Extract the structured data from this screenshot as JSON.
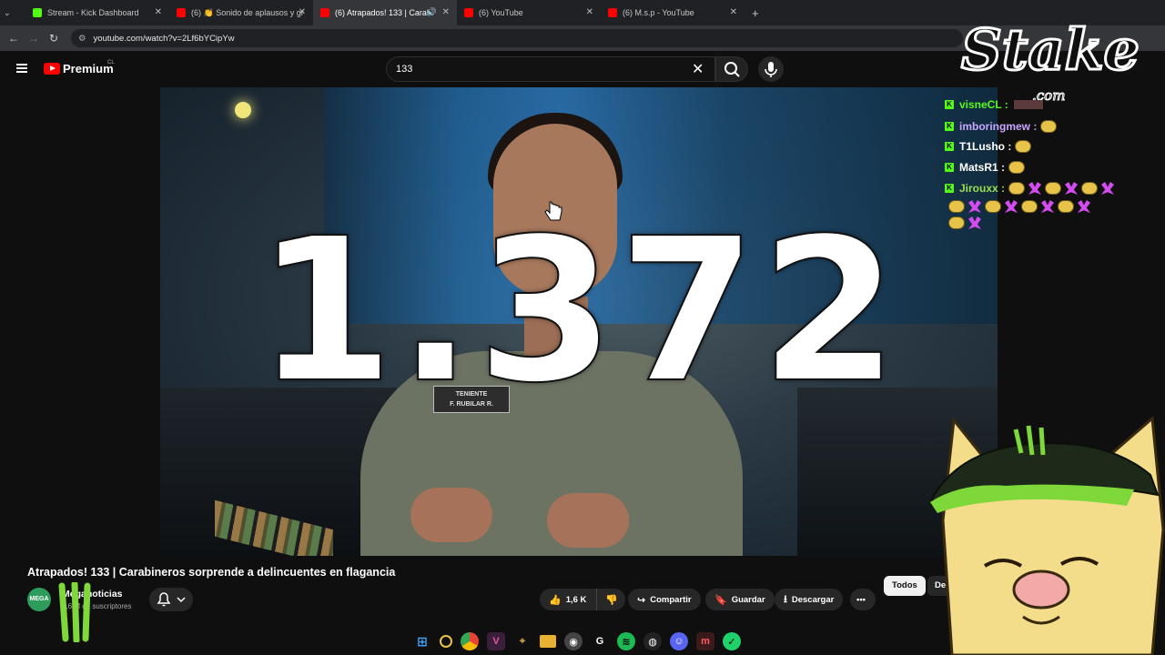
{
  "browser": {
    "tabs": [
      {
        "label": "Stream - Kick Dashboard",
        "color": "#53fc18",
        "active": false
      },
      {
        "label": "(6) 👏 Sonido de aplausos y gr",
        "color": "#ff0000",
        "active": false
      },
      {
        "label": "(6) Atrapados! 133 | Carabi",
        "color": "#ff0000",
        "active": true
      },
      {
        "label": "(6) YouTube",
        "color": "#ff0000",
        "active": false
      },
      {
        "label": "(6) M.s.p - YouTube",
        "color": "#ff0000",
        "active": false
      }
    ],
    "url": "youtube.com/watch?v=2Lf6bYCipYw"
  },
  "youtube": {
    "brand": "Premium",
    "region": "CL",
    "search_query": "133",
    "video": {
      "overlay_number": "1.372",
      "nametag_line1": "TENIENTE",
      "nametag_line2": "F. RUBILAR R."
    },
    "title": "Atrapados! 133 | Carabineros sorprende a delincuentes en flagancia",
    "channel_name": "Meganoticias",
    "channel_subs": "5,6 M de suscriptores",
    "avatar_text": "MEGA",
    "likes": "1,6 K",
    "share_label": "Compartir",
    "save_label": "Guardar",
    "download_label": "Descargar",
    "chips": [
      "Todos",
      "De"
    ]
  },
  "overlay": {
    "stake_text": "Stake",
    "stake_dot": ".com",
    "chat": [
      {
        "user": "visneCL :",
        "color": "#53fc18"
      },
      {
        "user": "imboringmew :",
        "color": "#c8a6ff"
      },
      {
        "user": "T1Lusho :",
        "color": "#ffffff"
      },
      {
        "user": "MatsR1 :",
        "color": "#ffffff"
      },
      {
        "user": "Jirouxx :",
        "color": "#9adf52"
      }
    ]
  },
  "colors": {
    "kick_green": "#53fc18",
    "youtube_red": "#ff0000",
    "background": "#0f0f0f"
  }
}
